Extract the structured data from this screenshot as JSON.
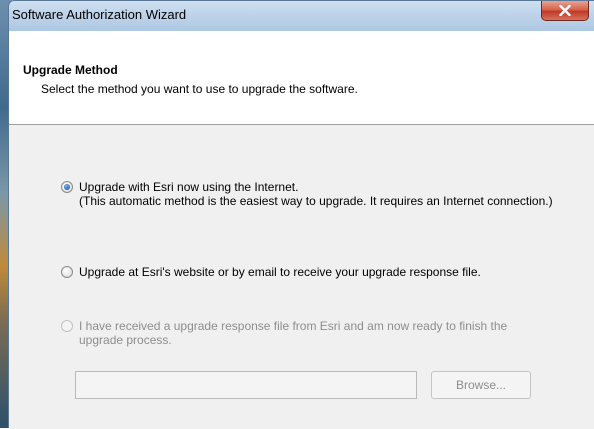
{
  "window": {
    "title": "Software Authorization Wizard"
  },
  "header": {
    "title": "Upgrade Method",
    "subtitle": "Select the method you want to use to upgrade the software."
  },
  "options": [
    {
      "lines": [
        "Upgrade with Esri now using the Internet.",
        "(This automatic method is the easiest way to upgrade. It requires an Internet connection.)"
      ],
      "checked": true,
      "enabled": true
    },
    {
      "lines": [
        "Upgrade at Esri's website or by email to receive your upgrade response file."
      ],
      "checked": false,
      "enabled": true
    },
    {
      "lines": [
        "I have received a upgrade response file from Esri and am now ready to finish the",
        "upgrade process."
      ],
      "checked": false,
      "enabled": false
    }
  ],
  "response_file": {
    "value": "",
    "browse_label": "Browse..."
  },
  "icons": {
    "close": "close-icon"
  },
  "colors": {
    "close_button": "#c0392b",
    "radio_selected": "#2c66b5",
    "disabled_text": "#8d8d8d"
  }
}
